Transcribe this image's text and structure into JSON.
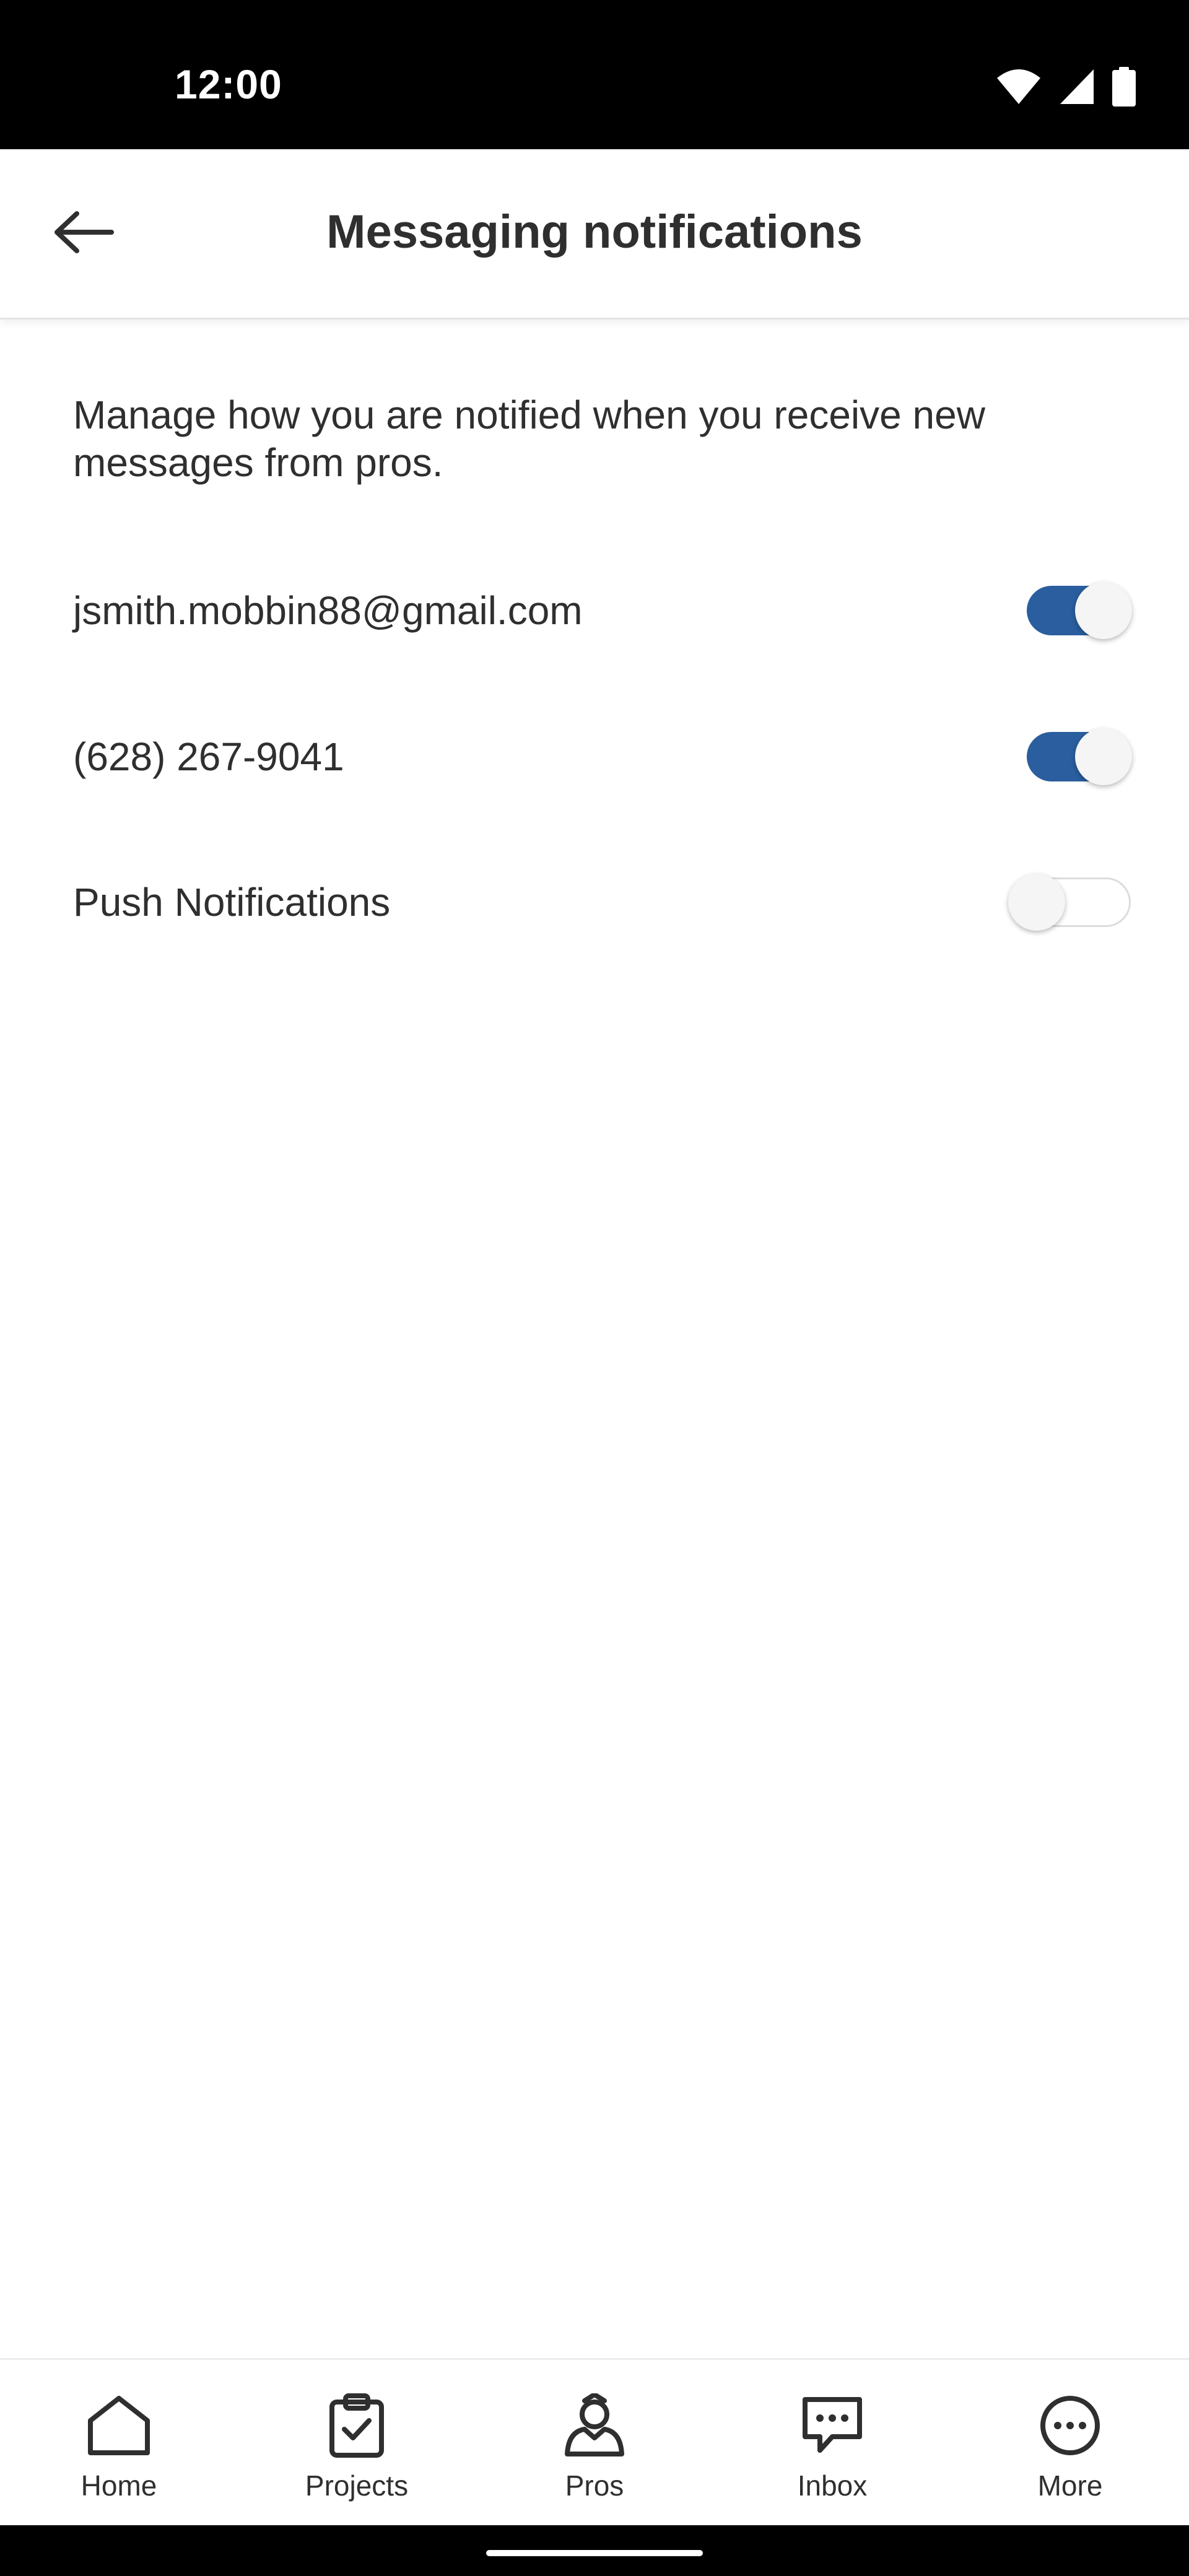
{
  "status_bar": {
    "time": "12:00",
    "icons": [
      "wifi-icon",
      "signal-icon",
      "battery-icon"
    ]
  },
  "header": {
    "title": "Messaging notifications",
    "back_icon": "arrow-left-icon"
  },
  "description": "Manage how you are notified when you receive new messages from pros.",
  "settings": [
    {
      "label": "jsmith.mobbin88@gmail.com",
      "enabled": true
    },
    {
      "label": "(628) 267-9041",
      "enabled": true
    },
    {
      "label": "Push Notifications",
      "enabled": false
    }
  ],
  "bottom_nav": {
    "items": [
      {
        "label": "Home",
        "icon": "home-icon"
      },
      {
        "label": "Projects",
        "icon": "clipboard-check-icon"
      },
      {
        "label": "Pros",
        "icon": "pro-person-icon"
      },
      {
        "label": "Inbox",
        "icon": "chat-bubble-icon"
      },
      {
        "label": "More",
        "icon": "more-dots-icon"
      }
    ]
  },
  "colors": {
    "toggle_on": "#2a5e9e",
    "text": "#2f2f2f",
    "status_bar": "#000000"
  }
}
